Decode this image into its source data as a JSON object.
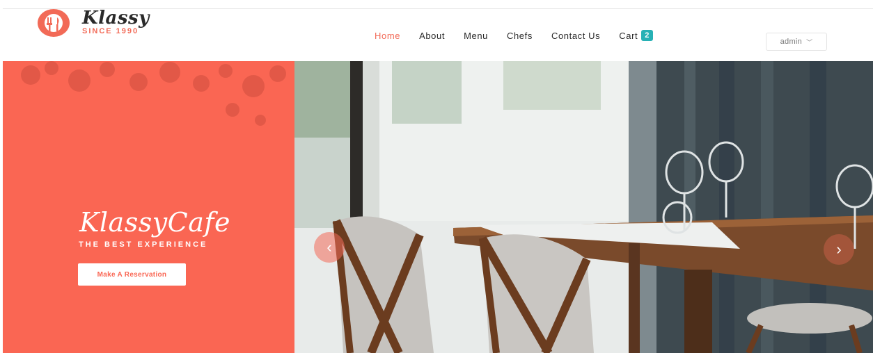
{
  "brand": {
    "name": "Klassy",
    "since": "SINCE 1990"
  },
  "nav": {
    "items": [
      {
        "label": "Home",
        "active": true
      },
      {
        "label": "About",
        "active": false
      },
      {
        "label": "Menu",
        "active": false
      },
      {
        "label": "Chefs",
        "active": false
      },
      {
        "label": "Contact Us",
        "active": false
      },
      {
        "label": "Cart",
        "active": false
      }
    ],
    "cart_count": "2"
  },
  "user_menu": {
    "value": "admin"
  },
  "hero": {
    "title": "KlassyCafe",
    "tagline": "THE BEST EXPERIENCE",
    "button_label": "Make A Reservation",
    "prev_arrow": "‹",
    "next_arrow": "›"
  },
  "colors": {
    "accent": "#fa6653",
    "brand_red": "#f26a57",
    "cart_badge": "#27b1b5"
  },
  "icons": {
    "logo": "fork-knife-icon",
    "dropdown": "chevron-down-icon",
    "prev": "chevron-left-icon",
    "next": "chevron-right-icon"
  }
}
